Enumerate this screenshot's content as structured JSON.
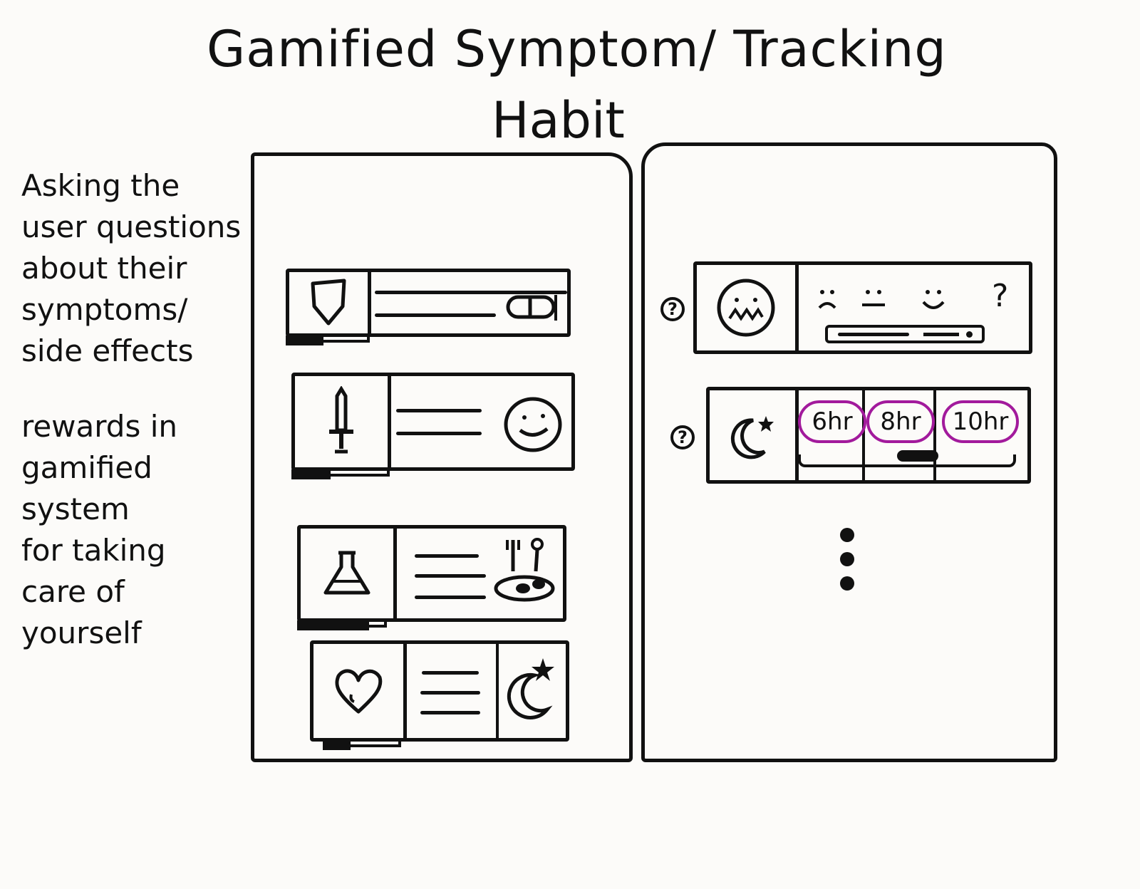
{
  "header": {
    "title_line1": "Gamified   Symptom/ Tracking",
    "title_line2": "Habit"
  },
  "notes": {
    "note1": [
      "Asking the",
      "user questions",
      "about their",
      "symptoms/",
      "side effects"
    ],
    "note2": [
      "rewards in",
      "gamified system",
      "for taking",
      "care of",
      "yourself"
    ]
  },
  "left_screen": {
    "cards": [
      {
        "icon": "shield-icon",
        "badge": "pill-icon",
        "progress": 0.45
      },
      {
        "icon": "sword-icon",
        "badge": "smiley-icon",
        "progress": 0.4
      },
      {
        "icon": "flask-icon",
        "badge": "food-icon",
        "progress": 0.8
      },
      {
        "icon": "heart-icon",
        "badge": "moon-star-icon",
        "progress": 0.35
      }
    ]
  },
  "right_screen": {
    "mood_card": {
      "icon": "sick-face-icon",
      "help": "?",
      "scale": [
        "sad-face-icon",
        "neutral-face-icon",
        "happy-face-icon",
        "?"
      ]
    },
    "sleep_card": {
      "icon": "moon-star-icon",
      "help": "?",
      "options": [
        "6hr",
        "8hr",
        "10hr"
      ],
      "slider_value": 0.55
    },
    "more_icon": "more-vertical-icon"
  },
  "colors": {
    "ink": "#111111",
    "highlight": "#a21a9c",
    "paper": "#fcfbf9"
  }
}
